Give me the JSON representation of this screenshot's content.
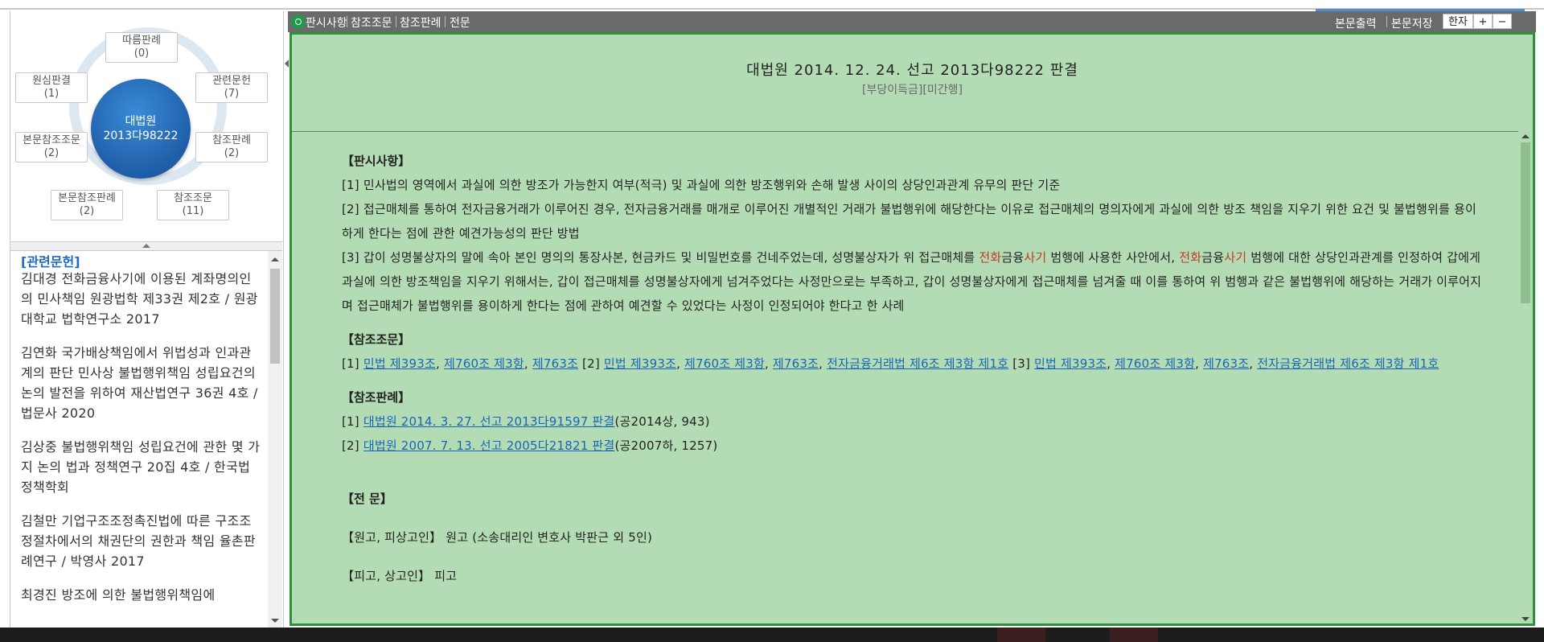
{
  "map": {
    "center": {
      "line1": "대법원",
      "line2": "2013다98222"
    },
    "nodes": [
      {
        "label": "따름판례",
        "count": "(0)"
      },
      {
        "label": "관련문헌",
        "count": "(7)"
      },
      {
        "label": "참조판례",
        "count": "(2)"
      },
      {
        "label": "참조조문",
        "count": "(11)"
      },
      {
        "label": "본문참조판례",
        "count": "(2)"
      },
      {
        "label": "본문참조조문",
        "count": "(2)"
      },
      {
        "label": "원심판결",
        "count": "(1)"
      }
    ]
  },
  "literature": {
    "title": "[관련문헌]",
    "items": [
      "김대경 전화금융사기에 이용된 계좌명의인의 민사책임 원광법학 제33권 제2호 / 원광대학교 법학연구소 2017",
      "김연화 국가배상책임에서 위법성과 인과관계의 판단 민사상 불법행위책임 성립요건의 논의 발전을 위하여 재산법연구 36권 4호 / 법문사 2020",
      "김상중 불법행위책임 성립요건에 관한 몇 가지 논의 법과 정책연구 20집 4호 / 한국법정책학회",
      "김철만 기업구조조정촉진법에 따른 구조조정절차에서의 채권단의 권한과 책임 율촌판례연구 / 박영사 2017",
      "최경진 방조에 의한 불법행위책임에"
    ]
  },
  "toolbar": {
    "tabs": [
      "판시사항",
      "참조조문",
      "참조판례",
      "전문"
    ],
    "print": "본문출력",
    "save": "본문저장",
    "hanja": "한자",
    "plus": "+",
    "minus": "−"
  },
  "document": {
    "title": "대법원 2014. 12. 24. 선고 2013다98222 판결",
    "subtitle": "[부당이득금][미간행]",
    "sec_holding": "【판시사항】",
    "holding1": "[1] 민사법의 영역에서 과실에 의한 방조가 가능한지 여부(적극) 및 과실에 의한 방조행위와 손해 발생 사이의 상당인과관계 유무의 판단 기준",
    "holding2": "[2] 접근매체를 통하여 전자금융거래가 이루어진 경우, 전자금융거래를 매개로 이루어진 개별적인 거래가 불법행위에 해당한다는 이유로 접근매체의 명의자에게 과실에 의한 방조 책임을 지우기 위한 요건 및 불법행위를 용이하게 한다는 점에 관한 예견가능성의 판단 방법",
    "h3_a": "[3] 갑이 성명불상자의 말에 속아 본인 명의의 통장사본, 현금카드 및 비밀번호를 건네주었는데, 성명불상자가 위 접근매체를 ",
    "h3_w1": "전화",
    "h3_b": "금융",
    "h3_w2": "사기",
    "h3_c": " 범행에 사용한 사안에서, ",
    "h3_w3": "전화",
    "h3_d": "금융",
    "h3_w4": "사기",
    "h3_e": " 범행에 대한 상당인과관계를 인정하여 갑에게 과실에 의한 방조책임을 지우기 위해서는, 갑이 접근매체를 성명불상자에게 넘겨주었다는 사정만으로는 부족하고, 갑이 성명불상자에게 접근매체를 넘겨줄 때 이를 통하여 위 범행과 같은 불법행위에 해당하는 거래가 이루어지며 접근매체가 불법행위를 용이하게 한다는 점에 관하여 예견할 수 있었다는 사정이 인정되어야 한다고 한 사례",
    "sec_statutes": "【참조조문】",
    "st_n1": "[1] ",
    "st_l1": "민법 제393조",
    "st_c1": ", ",
    "st_l2": "제760조 제3항",
    "st_c2": ", ",
    "st_l3": "제763조",
    "st_n2": " [2] ",
    "st_l4": "민법 제393조",
    "st_c3": ", ",
    "st_l5": "제760조 제3항",
    "st_c4": ", ",
    "st_l6": "제763조",
    "st_c5": ", ",
    "st_l7": "전자금융거래법 제6조 제3항 제1호",
    "st_n3": " [3] ",
    "st_l8": "민법 제393조",
    "st_c6": ", ",
    "st_l9": "제760조 제3항",
    "st_c7": ", ",
    "st_l10": "제763조",
    "st_c8": ", ",
    "st_l11": "전자금융거래법 제6조 제3항 제1호",
    "sec_cases": "【참조판례】",
    "case1_num": "[1] ",
    "case1_link": "대법원 2014. 3. 27. 선고 2013다91597 판결",
    "case1_tail": "(공2014상, 943)",
    "case2_num": "[2] ",
    "case2_link": "대법원 2007. 7. 13. 선고 2005다21821 판결",
    "case2_tail": "(공2007하, 1257)",
    "sec_full": "【전 문】",
    "plaintiff_label": "【원고, 피상고인】",
    "plaintiff_value": " 원고 (소송대리인 변호사 박판근 외 5인)",
    "defendant_label": "【피고, 상고인】",
    "defendant_value": " 피고"
  }
}
